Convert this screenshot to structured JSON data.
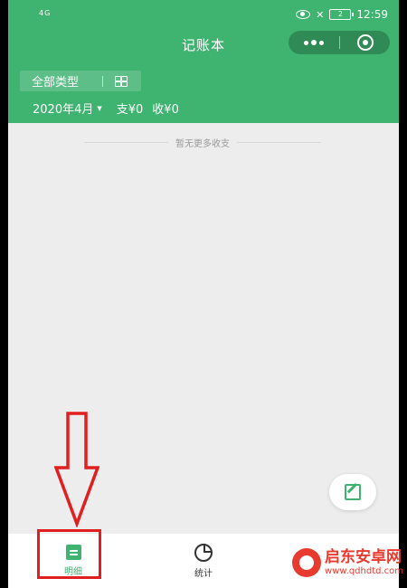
{
  "status_bar": {
    "signal": "4G",
    "time": "12:59",
    "battery": "2"
  },
  "header": {
    "title": "记账本"
  },
  "filter": {
    "type_label": "全部类型",
    "month": "2020年4月",
    "expense": "支¥0",
    "income": "收¥0"
  },
  "list": {
    "empty_text": "暂无更多收支"
  },
  "tabbar": {
    "tabs": [
      {
        "label": "明细",
        "color": "#3fb370"
      },
      {
        "label": "统计",
        "color": "#333333"
      }
    ]
  },
  "watermark": {
    "title": "启东安卓网",
    "url": "www.qdhdtd.com"
  },
  "colors": {
    "brand": "#3fb370",
    "annotation": "#e02020"
  },
  "icons": [
    "eye-icon",
    "battery-icon",
    "more-icon",
    "target-icon",
    "grid-icon",
    "caret-down-icon",
    "edit-icon",
    "detail-icon",
    "pie-icon",
    "arrow-down-icon"
  ]
}
